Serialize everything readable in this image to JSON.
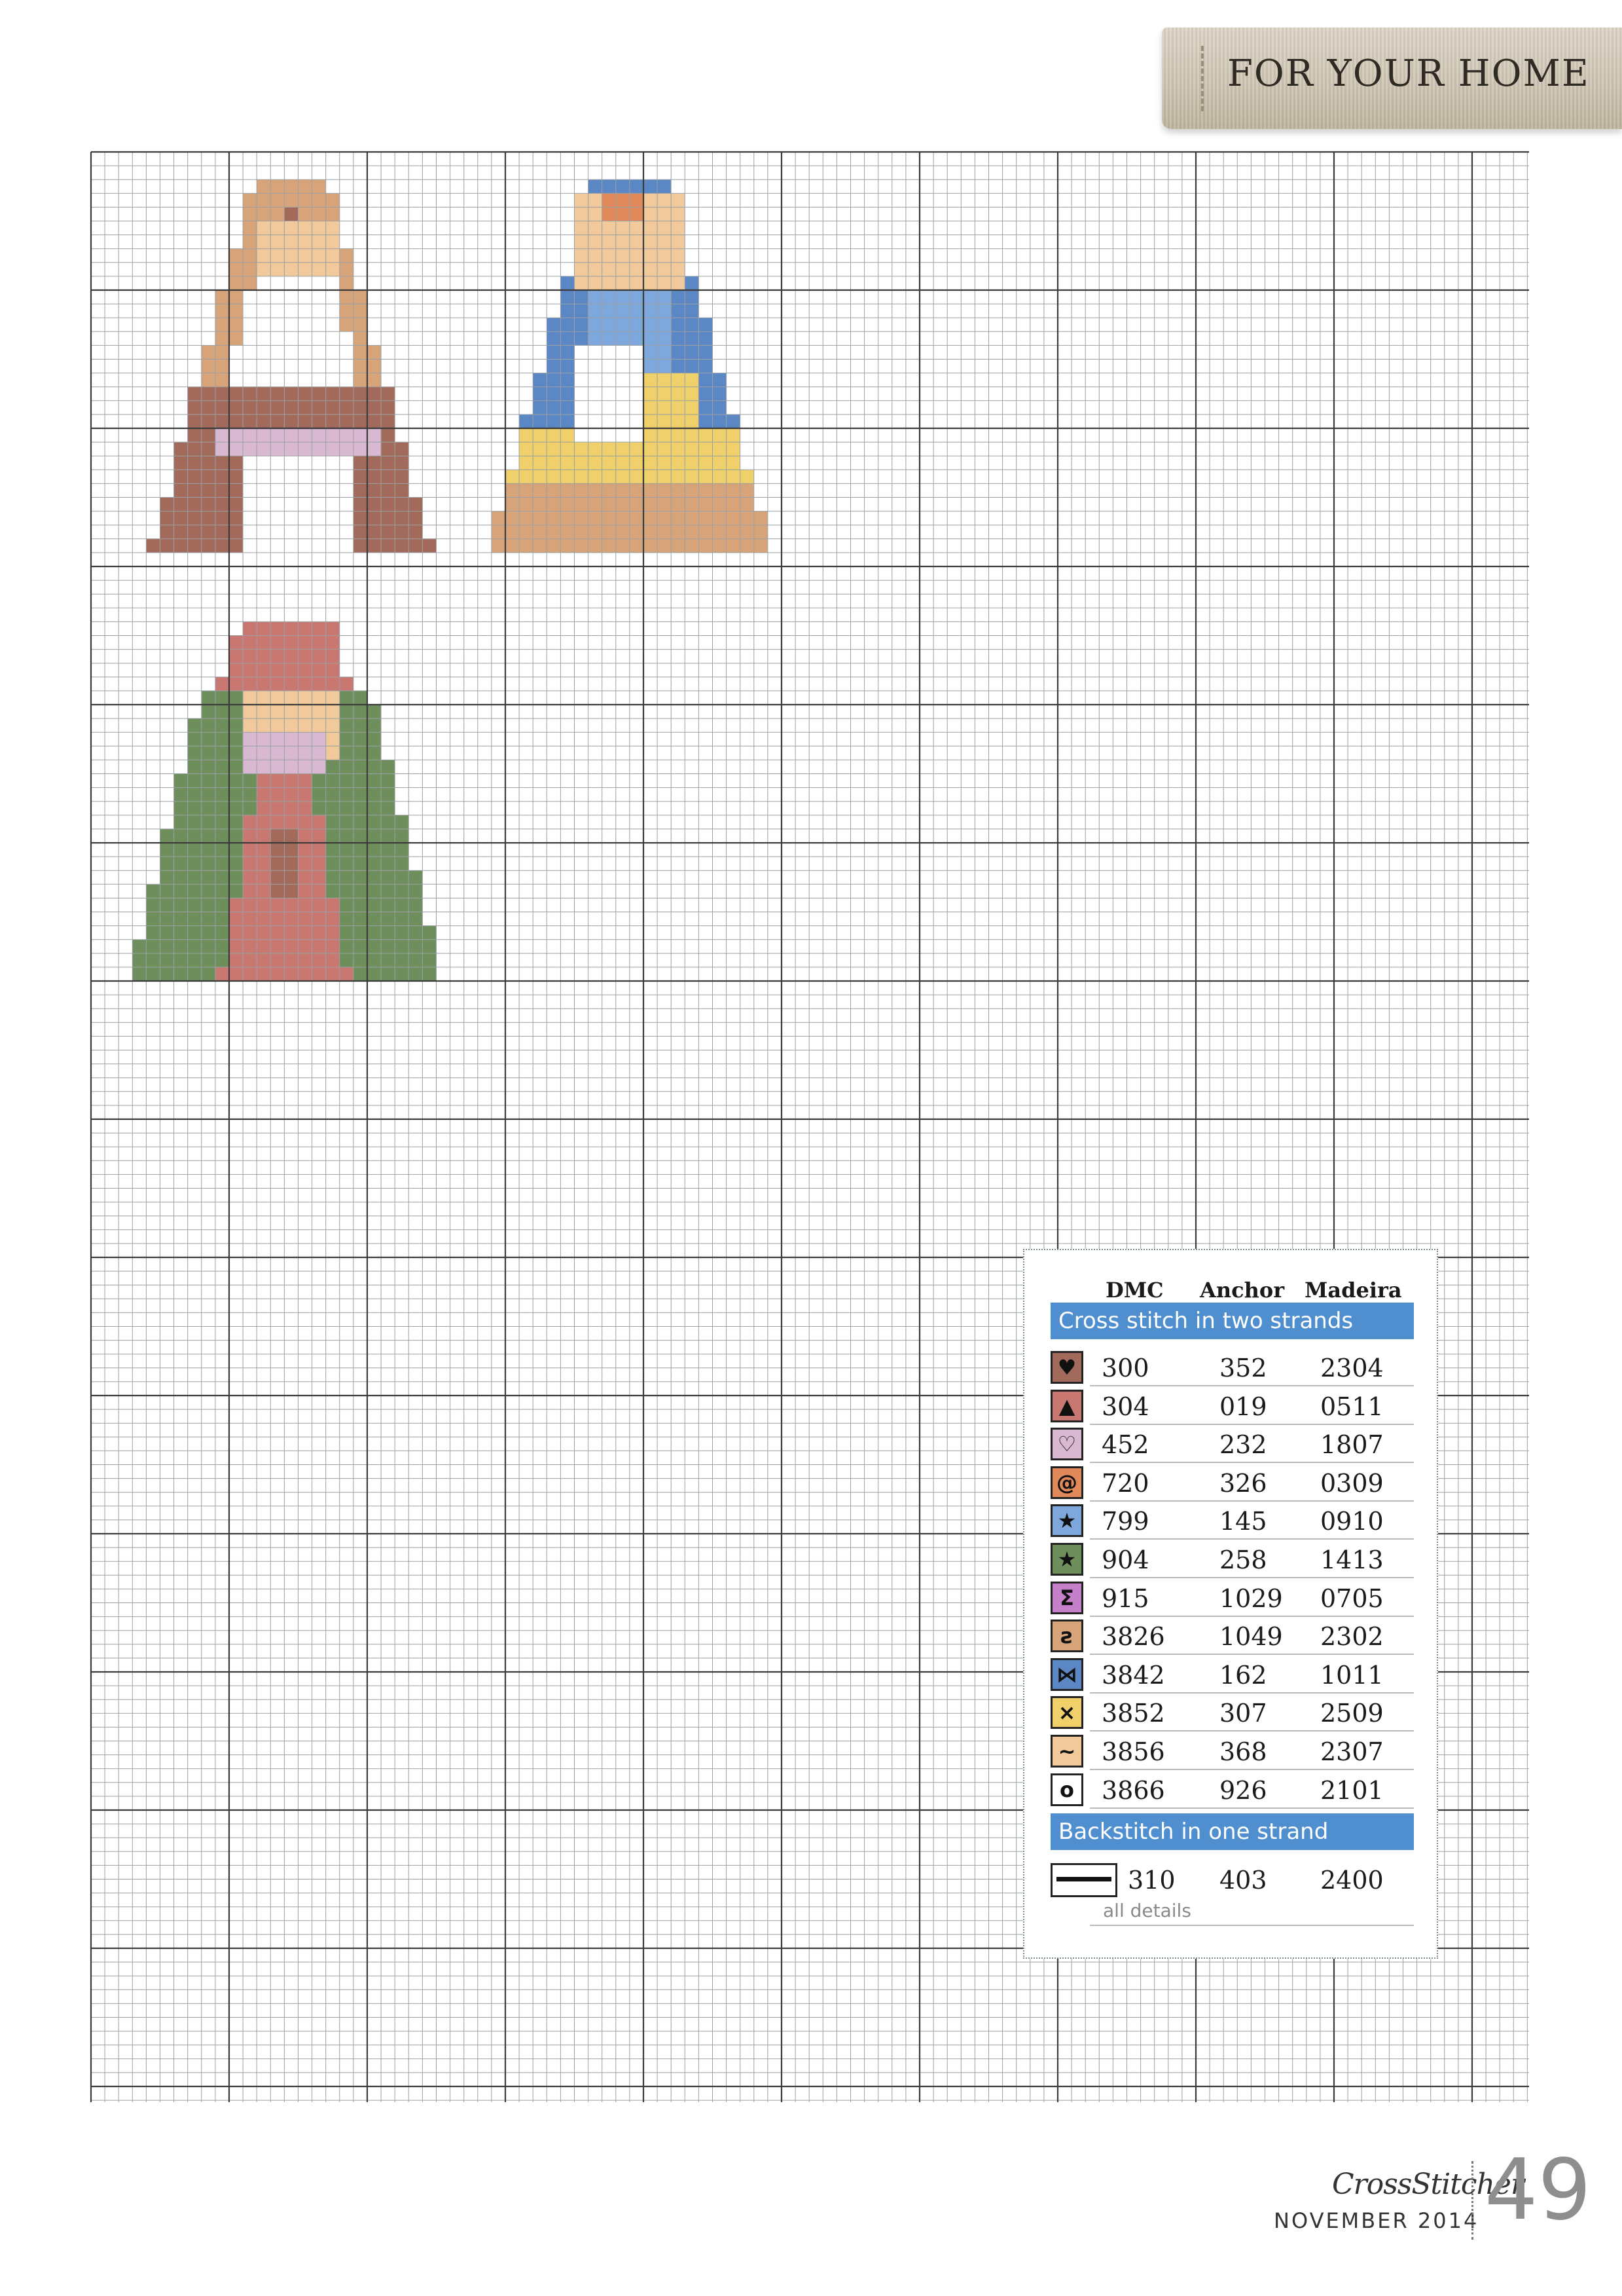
{
  "header": {
    "section": "FOR YOUR HOME"
  },
  "chart": {
    "colors": {
      "grid_line": "#9aa0a4",
      "grid_major": "#3b3b3b",
      "brown_300": "#a26a5a",
      "tan_3826": "#d7a47a",
      "cream_3856": "#f1c99a",
      "white_3866": "#ffffff",
      "rose_304": "#c97771",
      "lilac_452": "#d9b8d1",
      "blue_3842": "#5b88c4",
      "lightblue_799": "#7ea8db",
      "green_904": "#6e8f5c",
      "yellow_3852": "#efd06a",
      "orange_720": "#e0895a"
    }
  },
  "key": {
    "headers": {
      "dmc": "DMC",
      "anchor": "Anchor",
      "madeira": "Madeira"
    },
    "cross_title": "Cross stitch in two strands",
    "rows": [
      {
        "symbol": "♥",
        "color": "#a26a5a",
        "dmc": "300",
        "anchor": "352",
        "madeira": "2304"
      },
      {
        "symbol": "▲",
        "color": "#c97771",
        "dmc": "304",
        "anchor": "019",
        "madeira": "0511"
      },
      {
        "symbol": "♡",
        "color": "#d9b8d1",
        "dmc": "452",
        "anchor": "232",
        "madeira": "1807"
      },
      {
        "symbol": "@",
        "color": "#e0895a",
        "dmc": "720",
        "anchor": "326",
        "madeira": "0309"
      },
      {
        "symbol": "★",
        "color": "#7ea8db",
        "dmc": "799",
        "anchor": "145",
        "madeira": "0910"
      },
      {
        "symbol": "★",
        "color": "#6e8f5c",
        "dmc": "904",
        "anchor": "258",
        "madeira": "1413"
      },
      {
        "symbol": "Σ",
        "color": "#c580c9",
        "dmc": "915",
        "anchor": "1029",
        "madeira": "0705"
      },
      {
        "symbol": "ƨ",
        "color": "#d7a47a",
        "dmc": "3826",
        "anchor": "1049",
        "madeira": "2302"
      },
      {
        "symbol": "⋈",
        "color": "#5b88c4",
        "dmc": "3842",
        "anchor": "162",
        "madeira": "1011"
      },
      {
        "symbol": "×",
        "color": "#efd06a",
        "dmc": "3852",
        "anchor": "307",
        "madeira": "2509"
      },
      {
        "symbol": "~",
        "color": "#f1c99a",
        "dmc": "3856",
        "anchor": "368",
        "madeira": "2307"
      },
      {
        "symbol": "o",
        "color": "#ffffff",
        "dmc": "3866",
        "anchor": "926",
        "madeira": "2101"
      }
    ],
    "back_title": "Backstitch in one strand",
    "back_row": {
      "dmc": "310",
      "anchor": "403",
      "madeira": "2400",
      "note": "all details"
    }
  },
  "footer": {
    "brand": "CrossStitcher",
    "issue": "NOVEMBER 2014",
    "page": "49"
  }
}
